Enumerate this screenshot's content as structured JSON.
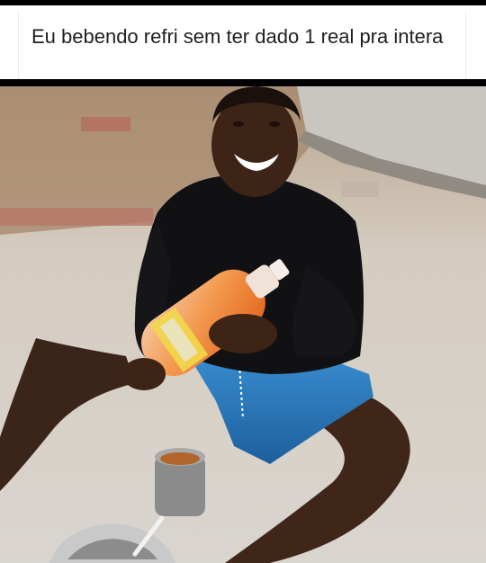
{
  "post": {
    "caption": "Eu bebendo refri sem ter dado 1 real pra intera"
  },
  "photo": {
    "subject": "smiling-boy-holding-soda-bottle"
  }
}
